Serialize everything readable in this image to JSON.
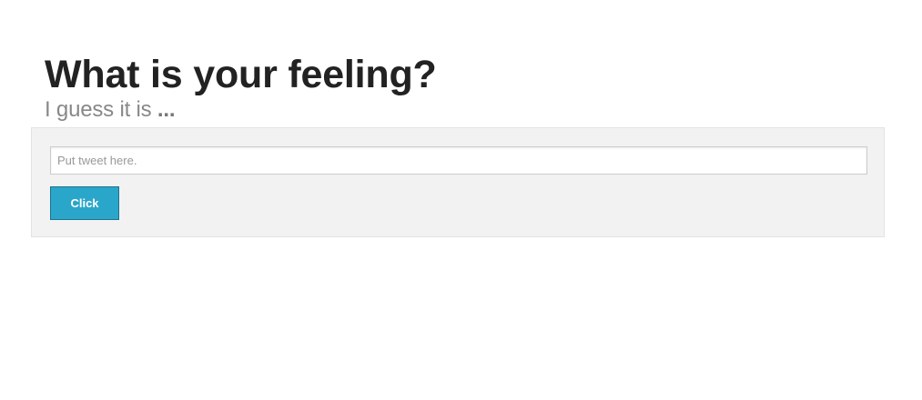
{
  "header": {
    "title": "What is your feeling?",
    "subtitle_prefix": "I guess it is",
    "subtitle_result": "..."
  },
  "form": {
    "input_value": "",
    "input_placeholder": "Put tweet here.",
    "button_label": "Click"
  },
  "colors": {
    "button_background": "#2ba6cb",
    "panel_background": "#f2f2f2",
    "title_text": "#222222",
    "subtitle_text": "#888888"
  }
}
